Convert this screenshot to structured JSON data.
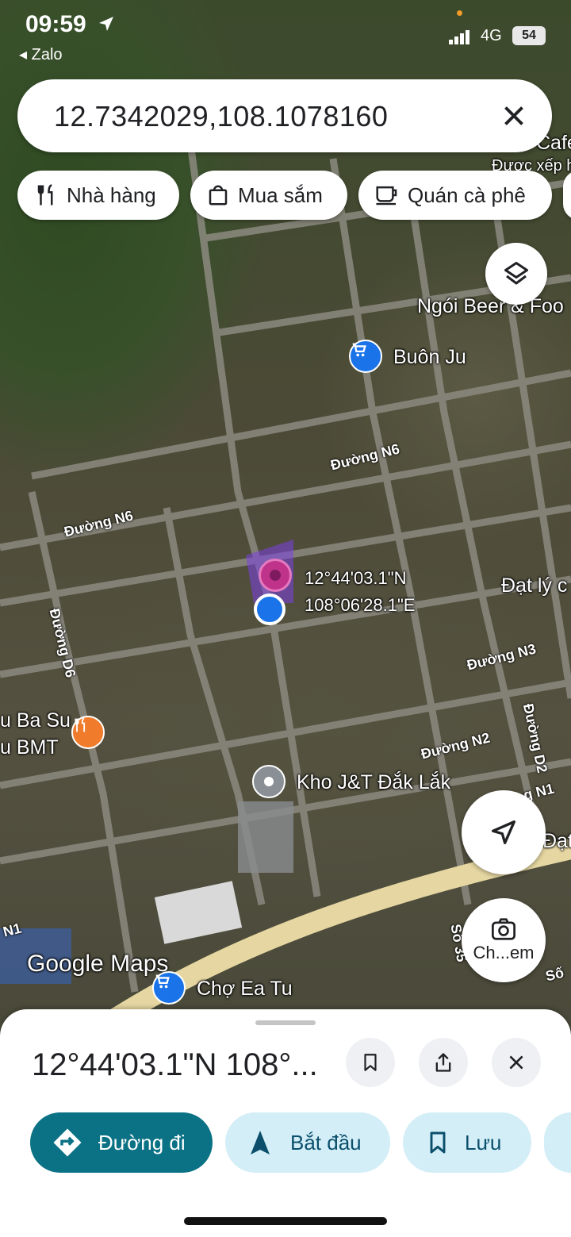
{
  "status_bar": {
    "time": "09:59",
    "back_app": "Zalo",
    "network": "4G",
    "battery": "54"
  },
  "search": {
    "value": "12.7342029,108.1078160",
    "clear_icon": "close-icon"
  },
  "chips": [
    {
      "label": "Nhà hàng",
      "icon": "restaurant-icon"
    },
    {
      "label": "Mua sắm",
      "icon": "shopping-bag-icon"
    },
    {
      "label": "Quán cà phê",
      "icon": "coffee-icon"
    }
  ],
  "map": {
    "places": {
      "cafe": "Cafe",
      "cafe_rating": "Được xếp h",
      "beer": "Ngói Beer & Foo",
      "buon_ju": "Buôn Ju",
      "dat_ly": "Đạt lý c",
      "ba_su_line1": "u Ba Su",
      "ba_su_line2": "u BMT",
      "kho_jt": "Kho J&T Đắk Lắk",
      "dat": "Đạt",
      "cho_ea_tu": "Chợ Ea Tu"
    },
    "roads": {
      "n6_a": "Đường N6",
      "n6_b": "Đường N6",
      "d6": "Đường D6",
      "n3": "Đường N3",
      "n2": "Đường N2",
      "d2": "Đường D2",
      "n1_a": "g N1",
      "n1_b": "N1",
      "so_35": "Số 35",
      "so": "Số"
    },
    "pin_lat": "12°44'03.1\"N",
    "pin_lng": "108°06'28.1\"E",
    "camera_label": "Ch...em",
    "watermark": "Google Maps"
  },
  "sheet": {
    "title": "12°44'03.1\"N 108°...",
    "actions": [
      {
        "label": "Đường đi"
      },
      {
        "label": "Bắt đầu"
      },
      {
        "label": "Lưu"
      }
    ]
  }
}
